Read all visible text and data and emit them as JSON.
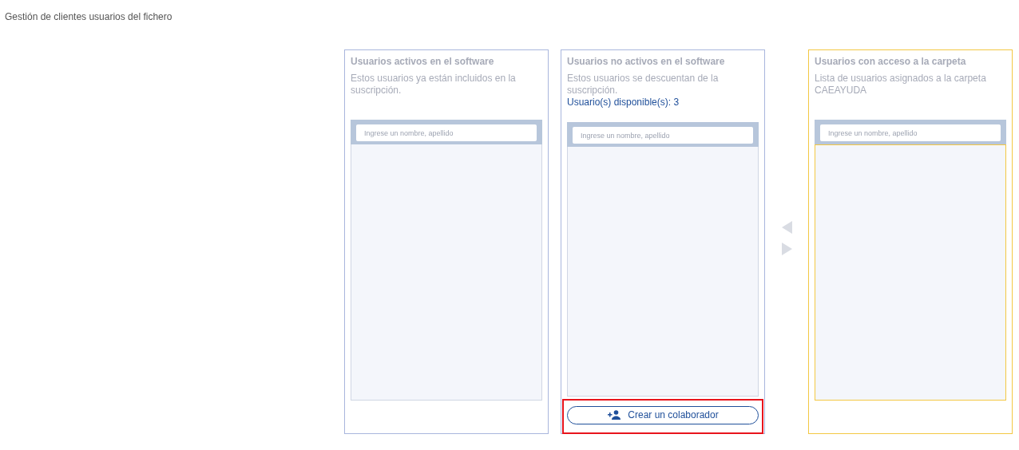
{
  "page_title": "Gestión de clientes usuarios del fichero",
  "panels": [
    {
      "kind": "active",
      "title": "Usuarios activos en el software",
      "description": "Estos usuarios ya están incluidos en la suscripción.",
      "search": {
        "placeholder": "Ingrese un nombre, apellido"
      },
      "selected": false
    },
    {
      "kind": "inactive",
      "title": "Usuarios no activos en el software",
      "description": "Estos usuarios se descuentan de la suscripción.",
      "available": "Usuario(s) disponible(s): 3",
      "search": {
        "placeholder": "Ingrese un nombre, apellido"
      },
      "selected": false,
      "button": {
        "label": "Crear un colaborador",
        "highlighted": true
      }
    },
    {
      "kind": "folder",
      "title": "Usuarios con acceso a la carpeta",
      "description": "Lista de usuarios asignados a la carpeta CAEAYUDA",
      "search": {
        "placeholder": "Ingrese un nombre, apellido"
      },
      "selected": true
    }
  ]
}
